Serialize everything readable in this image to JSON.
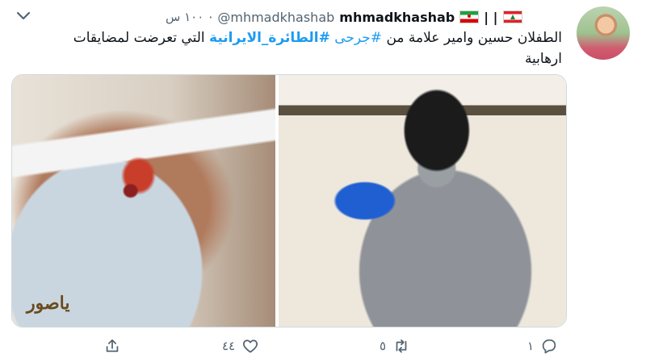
{
  "header": {
    "display_name": "mhmadkhashab",
    "name_separator": "| |",
    "handle": "@mhmadkhashab",
    "separator": "·",
    "time": "١٠٠ س"
  },
  "tweet": {
    "text_prefix": "الطفلان حسين وامير علامة من ",
    "hashtag1": "#جرحى",
    "space": " ",
    "hashtag2": "#الطائرة_الايرانية",
    "text_suffix": " التي تعرضت لمضايقات ارهابية"
  },
  "media": {
    "watermark": "ياصور"
  },
  "actions": {
    "reply_count": "١",
    "retweet_count": "٥",
    "like_count": "٤٤"
  },
  "icons": {
    "chevron": "chevron-down-icon",
    "reply": "reply-icon",
    "retweet": "retweet-icon",
    "like": "heart-icon",
    "share": "share-icon"
  },
  "colors": {
    "link": "#1d9bf0",
    "secondary_text": "#536471",
    "primary_text": "#0f1419"
  }
}
